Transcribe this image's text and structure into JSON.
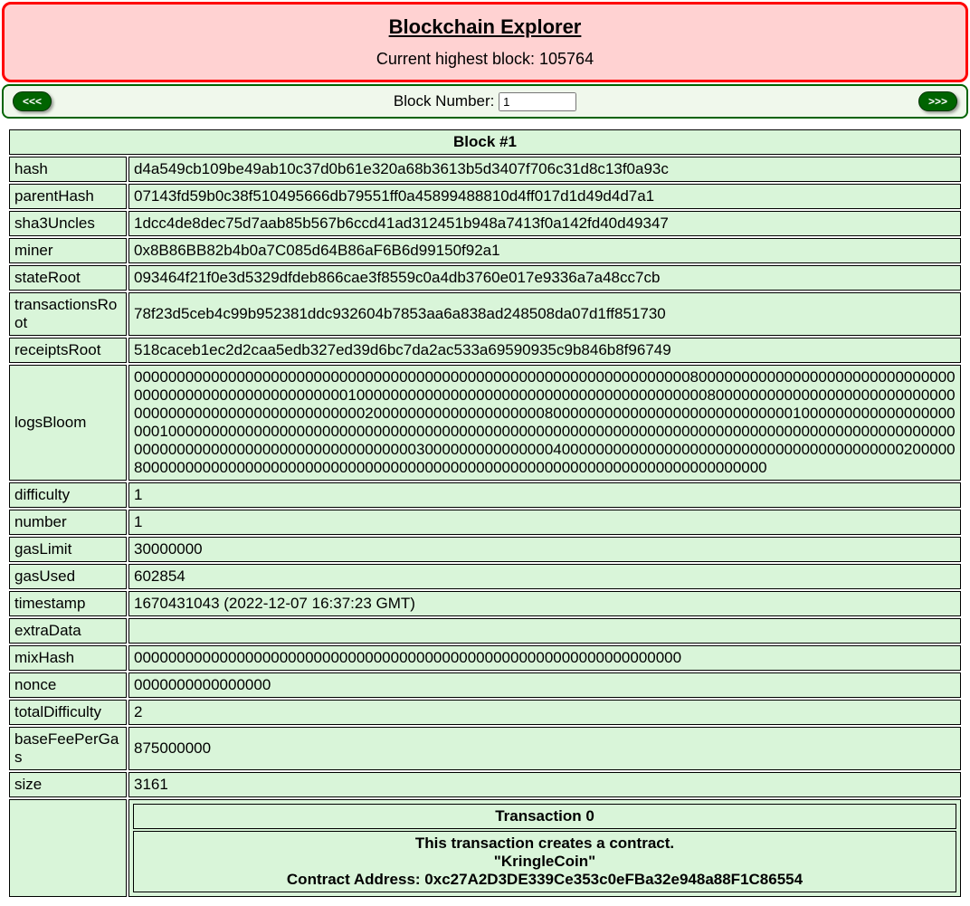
{
  "header": {
    "title": "Blockchain Explorer",
    "subtitle": "Current highest block: 105764"
  },
  "nav": {
    "prev_label": "<<<",
    "next_label": ">>>",
    "block_label": "Block Number: ",
    "block_value": "1"
  },
  "block": {
    "heading": "Block #1",
    "rows": [
      {
        "k": "hash",
        "v": "d4a549cb109be49ab10c37d0b61e320a68b3613b5d3407f706c31d8c13f0a93c"
      },
      {
        "k": "parentHash",
        "v": "07143fd59b0c38f510495666db79551ff0a45899488810d4ff017d1d49d4d7a1"
      },
      {
        "k": "sha3Uncles",
        "v": "1dcc4de8dec75d7aab85b567b6ccd41ad312451b948a7413f0a142fd40d49347"
      },
      {
        "k": "miner",
        "v": "0x8B86BB82b4b0a7C085d64B86aF6B6d99150f92a1"
      },
      {
        "k": "stateRoot",
        "v": "093464f21f0e3d5329dfdeb866cae3f8559c0a4db3760e017e9336a7a48cc7cb"
      },
      {
        "k": "transactionsRoot",
        "v": "78f23d5ceb4c99b952381ddc932604b7853aa6a838ad248508da07d1ff851730"
      },
      {
        "k": "receiptsRoot",
        "v": "518caceb1ec2d2caa5edb327ed39d6bc7da2ac533a69590935c9b846b8f96749"
      },
      {
        "k": "logsBloom",
        "v": "00000000000000000000000000000000000000000000000000000000000000000800000000000000000000000000000000000000000000000000000001000000000000000000000000000000000000000008000000000000000000000000000000000000000000000000000000020000000000000000000080000000000000000000000000000100000000000000000000010000000000000000000000000000000000000000000000000000000000000000000000000000000000000000000000000000000000000000000000000000030000000000000004000000000000000000000000000000000000000020000080000000000000000000000000000000000000000000000000000000000000000000000000"
      },
      {
        "k": "difficulty",
        "v": "1"
      },
      {
        "k": "number",
        "v": "1"
      },
      {
        "k": "gasLimit",
        "v": "30000000"
      },
      {
        "k": "gasUsed",
        "v": "602854"
      },
      {
        "k": "timestamp",
        "v": "1670431043 (2022-12-07 16:37:23 GMT)"
      },
      {
        "k": "extraData",
        "v": ""
      },
      {
        "k": "mixHash",
        "v": "0000000000000000000000000000000000000000000000000000000000000000"
      },
      {
        "k": "nonce",
        "v": "0000000000000000"
      },
      {
        "k": "totalDifficulty",
        "v": "2"
      },
      {
        "k": "baseFeePerGas",
        "v": "875000000"
      },
      {
        "k": "size",
        "v": "3161"
      }
    ],
    "tx": {
      "heading": "Transaction 0",
      "line1": "This transaction creates a contract.",
      "line2": "\"KringleCoin\"",
      "line3": "Contract Address: 0xc27A2D3DE339Ce353c0eFBa32e948a88F1C86554"
    }
  }
}
